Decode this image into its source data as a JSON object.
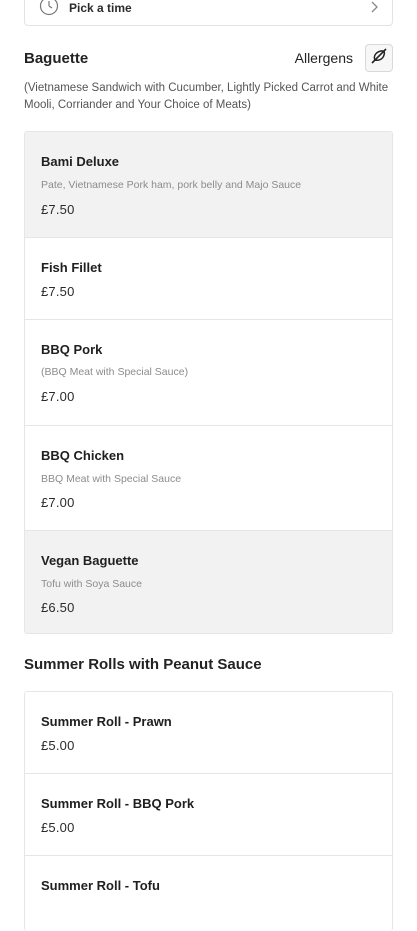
{
  "time_picker": {
    "label": "Pick a time",
    "icon": "clock-icon",
    "chevron": "chevron-right-icon"
  },
  "sections": {
    "baguette": {
      "title": "Baguette",
      "allergens_label": "Allergens",
      "allergens_icon": "allergen-icon",
      "description": "(Vietnamese Sandwich with Cucumber, Lightly Picked Carrot and White Mooli, Corriander and Your Choice of Meats)",
      "items": [
        {
          "name": "Bami Deluxe",
          "description": "Pate, Vietnamese Pork ham, pork belly and Majo Sauce",
          "price": "£7.50"
        },
        {
          "name": "Fish Fillet",
          "description": "",
          "price": "£7.50"
        },
        {
          "name": "BBQ Pork",
          "description": "(BBQ Meat with Special Sauce)",
          "price": "£7.00"
        },
        {
          "name": "BBQ Chicken",
          "description": "BBQ Meat with Special Sauce",
          "price": "£7.00"
        },
        {
          "name": "Vegan Baguette",
          "description": "Tofu with Soya Sauce",
          "price": "£6.50"
        }
      ]
    },
    "summer_rolls": {
      "title": "Summer Rolls with Peanut Sauce",
      "items": [
        {
          "name": "Summer Roll - Prawn",
          "price": "£5.00"
        },
        {
          "name": "Summer Roll - BBQ Pork",
          "price": "£5.00"
        },
        {
          "name": "Summer Roll - Tofu",
          "price": ""
        }
      ]
    }
  },
  "colors": {
    "shaded_item_bg": "#f2f2f2",
    "border": "#e6e6e6",
    "muted_text": "#8c8c8c"
  }
}
